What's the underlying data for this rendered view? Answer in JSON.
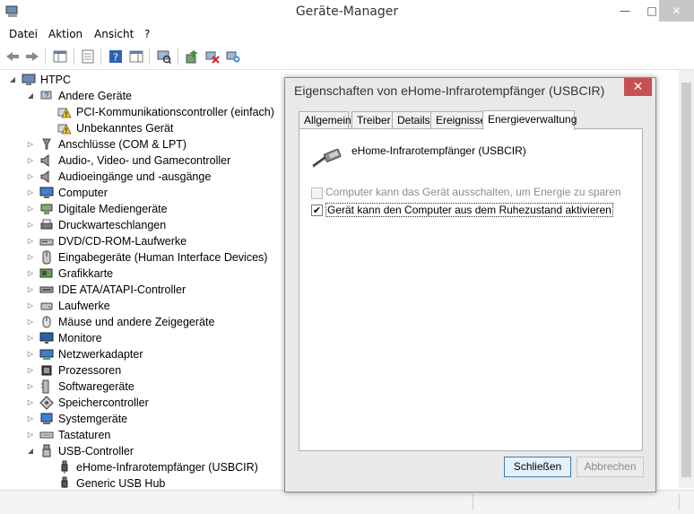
{
  "window": {
    "title": "Geräte-Manager"
  },
  "menu": [
    "Datei",
    "Aktion",
    "Ansicht",
    "?"
  ],
  "tree": {
    "root": "HTPC",
    "items": [
      {
        "label": "Andere Geräte",
        "icon": "unknown-device-icon",
        "expanded": true
      },
      {
        "label": "PCI-Kommunikationscontroller (einfach)",
        "icon": "warning-icon",
        "child": true
      },
      {
        "label": "Unbekanntes Gerät",
        "icon": "warning-icon",
        "child": true
      },
      {
        "label": "Anschlüsse (COM & LPT)",
        "icon": "port-icon"
      },
      {
        "label": "Audio-, Video- und Gamecontroller",
        "icon": "speaker-icon"
      },
      {
        "label": "Audioeingänge und -ausgänge",
        "icon": "speaker-icon"
      },
      {
        "label": "Computer",
        "icon": "computer-icon"
      },
      {
        "label": "Digitale Mediengeräte",
        "icon": "media-device-icon"
      },
      {
        "label": "Druckwarteschlangen",
        "icon": "printer-icon"
      },
      {
        "label": "DVD/CD-ROM-Laufwerke",
        "icon": "dvd-drive-icon"
      },
      {
        "label": "Eingabegeräte (Human Interface Devices)",
        "icon": "hid-icon"
      },
      {
        "label": "Grafikkarte",
        "icon": "display-adapter-icon"
      },
      {
        "label": "IDE ATA/ATAPI-Controller",
        "icon": "ide-controller-icon"
      },
      {
        "label": "Laufwerke",
        "icon": "disk-drive-icon"
      },
      {
        "label": "Mäuse und andere Zeigegeräte",
        "icon": "mouse-icon"
      },
      {
        "label": "Monitore",
        "icon": "monitor-icon"
      },
      {
        "label": "Netzwerkadapter",
        "icon": "network-adapter-icon"
      },
      {
        "label": "Prozessoren",
        "icon": "processor-icon"
      },
      {
        "label": "Softwaregeräte",
        "icon": "software-device-icon"
      },
      {
        "label": "Speichercontroller",
        "icon": "storage-controller-icon"
      },
      {
        "label": "Systemgeräte",
        "icon": "system-device-icon"
      },
      {
        "label": "Tastaturen",
        "icon": "keyboard-icon"
      },
      {
        "label": "USB-Controller",
        "icon": "usb-icon",
        "expanded": true
      },
      {
        "label": "eHome-Infrarotempfänger (USBCIR)",
        "icon": "usb-plug-icon",
        "child": true
      },
      {
        "label": "Generic USB Hub",
        "icon": "usb-plug-icon",
        "child": true
      }
    ]
  },
  "dialog": {
    "title": "Eigenschaften von eHome-Infrarotempfänger (USBCIR)",
    "close": "✕",
    "tabs": [
      "Allgemein",
      "Treiber",
      "Details",
      "Ereignisse",
      "Energieverwaltung"
    ],
    "active_tab": "Energieverwaltung",
    "device_name": "eHome-Infrarotempfänger (USBCIR)",
    "options": [
      {
        "label": "Computer kann das Gerät ausschalten, um Energie zu sparen",
        "checked": false,
        "enabled": false
      },
      {
        "label": "Gerät kann den Computer aus dem Ruhezustand aktivieren",
        "checked": true,
        "enabled": true
      }
    ],
    "buttons": {
      "ok": "Schließen",
      "cancel": "Abbrechen"
    }
  },
  "colors": {
    "close_red": "#c75050",
    "accent_blue": "#3c7fb1",
    "warning_yellow": "#f2c230"
  }
}
